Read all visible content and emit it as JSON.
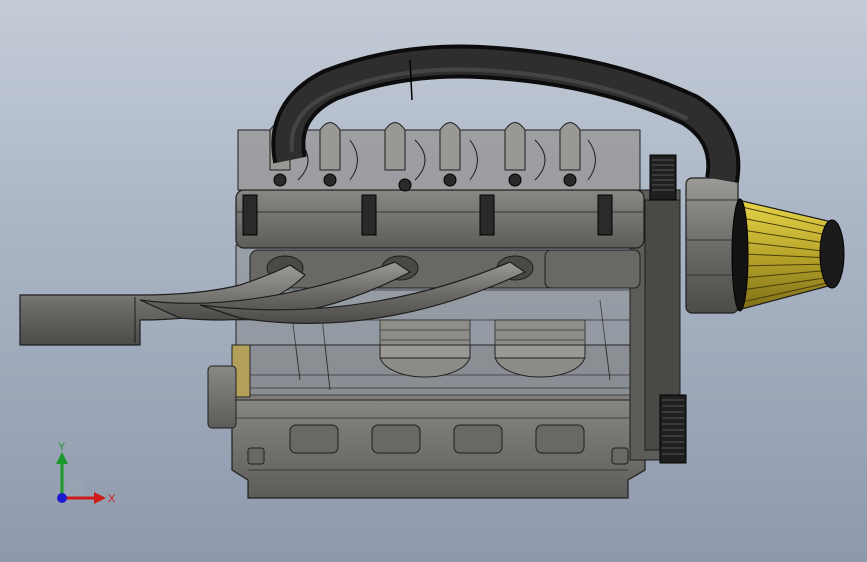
{
  "viewport": {
    "background_top": "#c5ccd8",
    "background_bottom": "#8e9aac"
  },
  "model": {
    "description_icon": "engine-assembly",
    "colors": {
      "body": "#7d7b77",
      "body_dark": "#4a4946",
      "edge": "#1e1e1e",
      "hose": "#1b1b1b",
      "filter": "#c9b62e",
      "pulley": "#2a2a2a",
      "accent": "#b3a05a"
    }
  },
  "triad": {
    "x_label": "X",
    "y_label": "Y",
    "x_color": "#d01a1a",
    "y_color": "#1a9a2a",
    "z_color": "#1a1ad0"
  }
}
